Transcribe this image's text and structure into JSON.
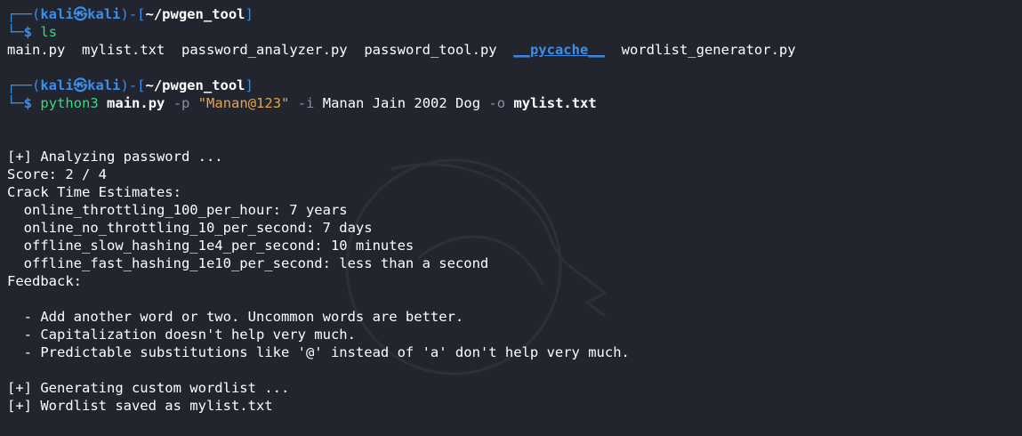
{
  "prompt": {
    "user": "kali",
    "symbol": "㉿",
    "host": "kali",
    "path": "~/pwgen_tool",
    "dollar": "$"
  },
  "cmd1": {
    "text": "ls"
  },
  "ls_output": {
    "files": [
      "main.py",
      "mylist.txt",
      "password_analyzer.py",
      "password_tool.py"
    ],
    "dir": "__pycache__",
    "last": "wordlist_generator.py"
  },
  "cmd2": {
    "program": "python3",
    "script": "main.py",
    "flag_p": "-p",
    "password": "\"Manan@123\"",
    "flag_i": "-i",
    "info": "Manan Jain 2002 Dog",
    "flag_o": "-o",
    "outfile": "mylist.txt"
  },
  "output": {
    "analyzing": "[+] Analyzing password ...",
    "score": "Score: 2 / 4",
    "crack_header": "Crack Time Estimates:",
    "estimates": [
      "  online_throttling_100_per_hour: 7 years",
      "  online_no_throttling_10_per_second: 7 days",
      "  offline_slow_hashing_1e4_per_second: 10 minutes",
      "  offline_fast_hashing_1e10_per_second: less than a second"
    ],
    "feedback_header": "Feedback:",
    "feedback": [
      "  - Add another word or two. Uncommon words are better.",
      "  - Capitalization doesn't help very much.",
      "  - Predictable substitutions like '@' instead of 'a' don't help very much."
    ],
    "generating": "[+] Generating custom wordlist ...",
    "saved": "[+] Wordlist saved as mylist.txt"
  }
}
